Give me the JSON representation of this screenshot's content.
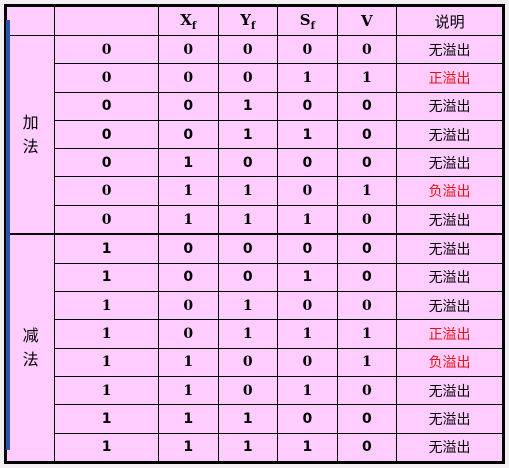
{
  "header": {
    "blank": "",
    "blank2": "",
    "xf": "X",
    "xf_sub": "f",
    "yf": "Y",
    "yf_sub": "f",
    "sf": "S",
    "sf_sub": "f",
    "v": "V",
    "desc": "说明"
  },
  "groups": {
    "add": [
      "加",
      "法"
    ],
    "sub": [
      "减",
      "法"
    ]
  },
  "rows": [
    {
      "a": "0",
      "xf": "0",
      "yf": "0",
      "sf": "0",
      "v": "0",
      "desc": "无溢出",
      "overflow": false
    },
    {
      "a": "0",
      "xf": "0",
      "yf": "0",
      "sf": "1",
      "v": "1",
      "desc": "正溢出",
      "overflow": true
    },
    {
      "a": "0",
      "xf": "0",
      "yf": "1",
      "sf": "0",
      "v": "0",
      "desc": "无溢出",
      "overflow": false
    },
    {
      "a": "0",
      "xf": "0",
      "yf": "1",
      "sf": "1",
      "v": "0",
      "desc": "无溢出",
      "overflow": false
    },
    {
      "a": "0",
      "xf": "1",
      "yf": "0",
      "sf": "0",
      "v": "0",
      "desc": "无溢出",
      "overflow": false
    },
    {
      "a": "0",
      "xf": "1",
      "yf": "1",
      "sf": "0",
      "v": "1",
      "desc": "负溢出",
      "overflow": true
    },
    {
      "a": "0",
      "xf": "1",
      "yf": "1",
      "sf": "1",
      "v": "0",
      "desc": "无溢出",
      "overflow": false
    },
    {
      "a": "1",
      "xf": "0",
      "yf": "0",
      "sf": "0",
      "v": "0",
      "desc": "无溢出",
      "overflow": false
    },
    {
      "a": "1",
      "xf": "0",
      "yf": "0",
      "sf": "1",
      "v": "0",
      "desc": "无溢出",
      "overflow": false
    },
    {
      "a": "1",
      "xf": "0",
      "yf": "1",
      "sf": "0",
      "v": "0",
      "desc": "无溢出",
      "overflow": false
    },
    {
      "a": "1",
      "xf": "0",
      "yf": "1",
      "sf": "1",
      "v": "1",
      "desc": "正溢出",
      "overflow": true
    },
    {
      "a": "1",
      "xf": "1",
      "yf": "0",
      "sf": "0",
      "v": "1",
      "desc": "负溢出",
      "overflow": true
    },
    {
      "a": "1",
      "xf": "1",
      "yf": "0",
      "sf": "1",
      "v": "0",
      "desc": "无溢出",
      "overflow": false
    },
    {
      "a": "1",
      "xf": "1",
      "yf": "1",
      "sf": "0",
      "v": "0",
      "desc": "无溢出",
      "overflow": false
    },
    {
      "a": "1",
      "xf": "1",
      "yf": "1",
      "sf": "1",
      "v": "0",
      "desc": "无溢出",
      "overflow": false
    }
  ],
  "colors": {
    "table_bg": "#ffccff",
    "overflow_text": "#e81010",
    "accent_bar": "#2a55a8"
  }
}
